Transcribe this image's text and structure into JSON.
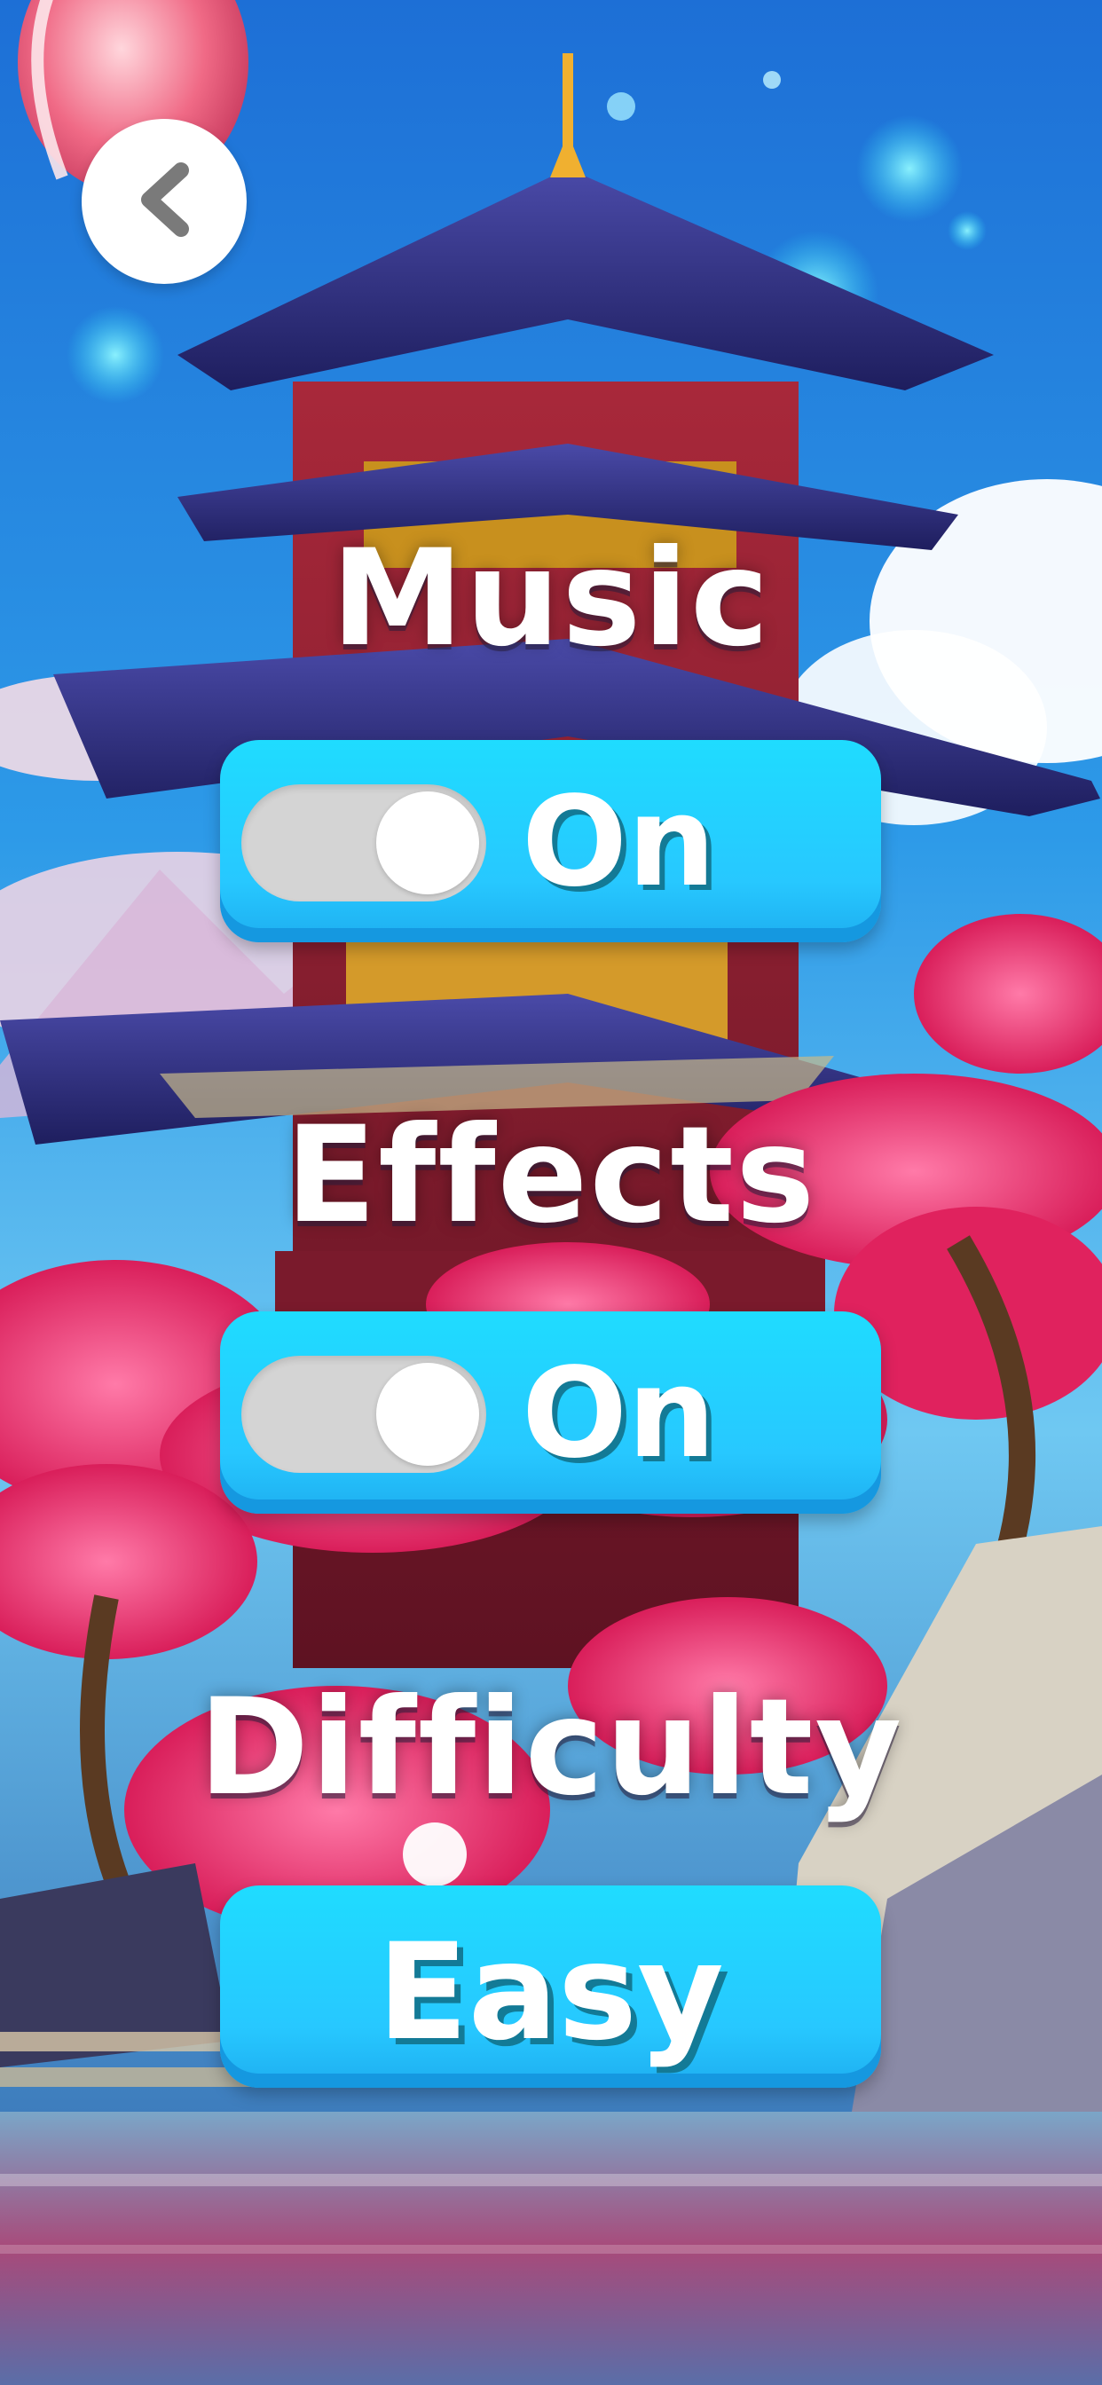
{
  "colors": {
    "button_fill": "#27c8ff",
    "button_shadow": "#1598e0",
    "toggle_track": "#d4d4d4",
    "label_text": "#ffffff",
    "value_shadow": "#137a96"
  },
  "back_button": {
    "icon": "chevron-left-icon"
  },
  "settings": {
    "music": {
      "label": "Music",
      "value": "On",
      "toggled": true
    },
    "effects": {
      "label": "Effects",
      "value": "On",
      "toggled": true
    },
    "difficulty": {
      "label": "Difficulty",
      "value": "Easy"
    }
  },
  "background": {
    "scene": "pagoda-cherry-blossom-illustration"
  }
}
